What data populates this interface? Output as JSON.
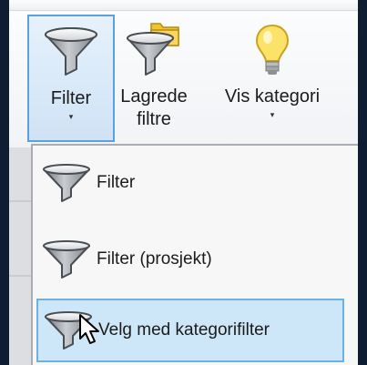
{
  "ribbon": {
    "filter": {
      "label": "Filter",
      "arrow": "▾"
    },
    "saved_filters": {
      "label_line1": "Lagrede",
      "label_line2": "filtre"
    },
    "show_category": {
      "label": "Vis kategori",
      "arrow": "▾"
    }
  },
  "menu": {
    "items": [
      {
        "label": "Filter",
        "icon": "funnel-icon"
      },
      {
        "label": "Filter (prosjekt)",
        "icon": "funnel-icon"
      },
      {
        "label": "Velg med  kategorifilter",
        "icon": "funnel-icon",
        "hovered": true
      }
    ]
  },
  "colors": {
    "background": "#0f1d33",
    "active_border": "#5aa2df",
    "hover_fill": "#cde6f8",
    "funnel_fill": "#8e9296",
    "folder_yellow": "#f2c230",
    "bulb_yellow": "#fbe36a"
  }
}
